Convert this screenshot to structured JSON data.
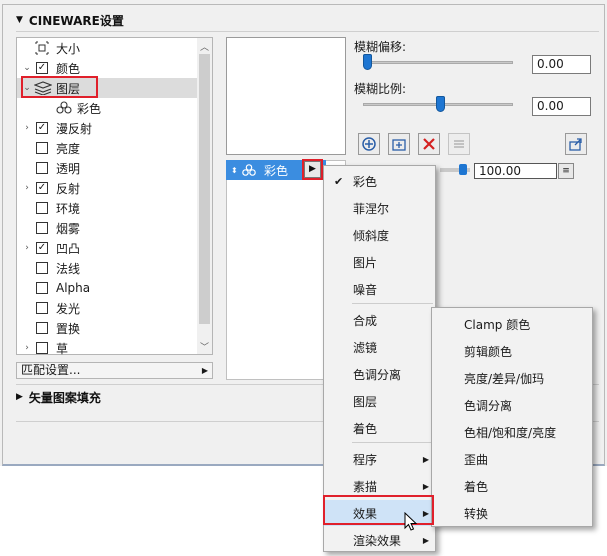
{
  "section1": {
    "title": "CINEWARE设置",
    "arrow": "▼"
  },
  "section2": {
    "title": "矢量图案填充",
    "arrow": "▶"
  },
  "tree": {
    "items": [
      {
        "label": "大小",
        "expander": "",
        "icon": "size-icon",
        "checkbox": "none"
      },
      {
        "label": "颜色",
        "expander": "⌄",
        "icon": "",
        "checkbox": "checked"
      },
      {
        "label": "图层",
        "expander": "⌄",
        "icon": "layers-icon",
        "checkbox": "none",
        "selected": true
      },
      {
        "label": "彩色",
        "expander": "",
        "icon": "shader-icon",
        "checkbox": "none",
        "child": true
      },
      {
        "label": "漫反射",
        "expander": "›",
        "icon": "",
        "checkbox": "checked"
      },
      {
        "label": "亮度",
        "expander": "",
        "icon": "",
        "checkbox": "unchecked"
      },
      {
        "label": "透明",
        "expander": "",
        "icon": "",
        "checkbox": "unchecked"
      },
      {
        "label": "反射",
        "expander": "›",
        "icon": "",
        "checkbox": "checked"
      },
      {
        "label": "环境",
        "expander": "",
        "icon": "",
        "checkbox": "unchecked"
      },
      {
        "label": "烟雾",
        "expander": "",
        "icon": "",
        "checkbox": "unchecked"
      },
      {
        "label": "凹凸",
        "expander": "›",
        "icon": "",
        "checkbox": "checked"
      },
      {
        "label": "法线",
        "expander": "",
        "icon": "",
        "checkbox": "unchecked"
      },
      {
        "label": "Alpha",
        "expander": "",
        "icon": "",
        "checkbox": "unchecked"
      },
      {
        "label": "发光",
        "expander": "",
        "icon": "",
        "checkbox": "unchecked"
      },
      {
        "label": "置换",
        "expander": "",
        "icon": "",
        "checkbox": "unchecked"
      },
      {
        "label": "草",
        "expander": "›",
        "icon": "",
        "checkbox": "unchecked"
      }
    ]
  },
  "match_button": {
    "label": "匹配设置..."
  },
  "blur_offset": {
    "label": "模糊偏移:",
    "value": "0.00",
    "level": 0.0
  },
  "blur_scale": {
    "label": "模糊比例:",
    "value": "0.00",
    "level": 0.5
  },
  "layer_list": {
    "selected": "彩色"
  },
  "brightness": {
    "value": "100.00"
  },
  "shader_menu": {
    "items": [
      {
        "label": "彩色",
        "checked": true
      },
      {
        "label": "菲涅尔"
      },
      {
        "label": "倾斜度"
      },
      {
        "label": "图片"
      },
      {
        "label": "噪音",
        "sep_after": true
      },
      {
        "label": "合成"
      },
      {
        "label": "滤镜"
      },
      {
        "label": "色调分离"
      },
      {
        "label": "图层"
      },
      {
        "label": "着色",
        "sep_after": true
      },
      {
        "label": "程序",
        "submenu": true
      },
      {
        "label": "素描",
        "submenu": true
      },
      {
        "label": "效果",
        "submenu": true,
        "active": true
      },
      {
        "label": "渲染效果",
        "submenu": true
      }
    ]
  },
  "effects_menu": {
    "items": [
      {
        "label": "Clamp 颜色"
      },
      {
        "label": "剪辑颜色"
      },
      {
        "label": "亮度/差异/伽玛"
      },
      {
        "label": "色调分离"
      },
      {
        "label": "色相/饱和度/亮度"
      },
      {
        "label": "歪曲"
      },
      {
        "label": "着色"
      },
      {
        "label": "转换"
      }
    ]
  },
  "colors": {
    "accent": "#3b8de0",
    "highlight": "#e0202b",
    "slider": "#1e76d2"
  }
}
